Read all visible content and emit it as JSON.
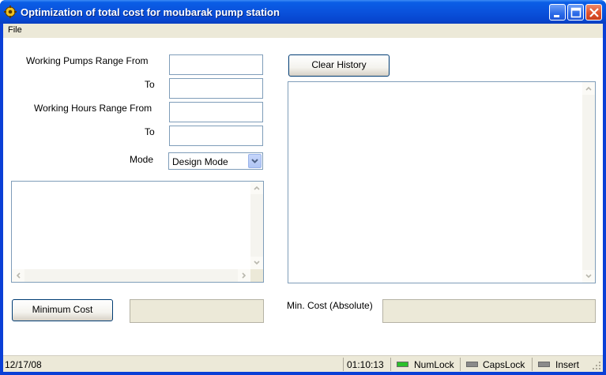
{
  "window": {
    "title": "Optimization of total cost for moubarak pump station"
  },
  "menu": {
    "file": "File"
  },
  "form": {
    "pumps_from_label": "Working Pumps Range From",
    "pumps_to_label": "To",
    "hours_from_label": "Working Hours Range From",
    "hours_to_label": "To",
    "mode_label": "Mode",
    "mode_value": "Design Mode",
    "pumps_from_value": "",
    "pumps_to_value": "",
    "hours_from_value": "",
    "hours_to_value": ""
  },
  "buttons": {
    "clear_history": "Clear History",
    "minimum_cost": "Minimum Cost"
  },
  "results": {
    "min_cost_abs_label": "Min. Cost (Absolute)",
    "min_cost_value": "",
    "min_cost_abs_value": ""
  },
  "status": {
    "date": "12/17/08",
    "time": "01:10:13",
    "numlock": "NumLock",
    "capslock": "CapsLock",
    "insert": "Insert",
    "numlock_on": true,
    "capslock_on": false,
    "insert_on": false
  },
  "icons": {
    "app": "gear-icon",
    "minimize": "minimize-icon",
    "maximize": "maximize-icon",
    "close": "close-icon",
    "dropdown": "chevron-down-icon"
  },
  "colors": {
    "title_bar": "#0a52dc",
    "close_button": "#e0522c",
    "led_on": "#2bc02b",
    "led_off": "#8a8a8a"
  }
}
